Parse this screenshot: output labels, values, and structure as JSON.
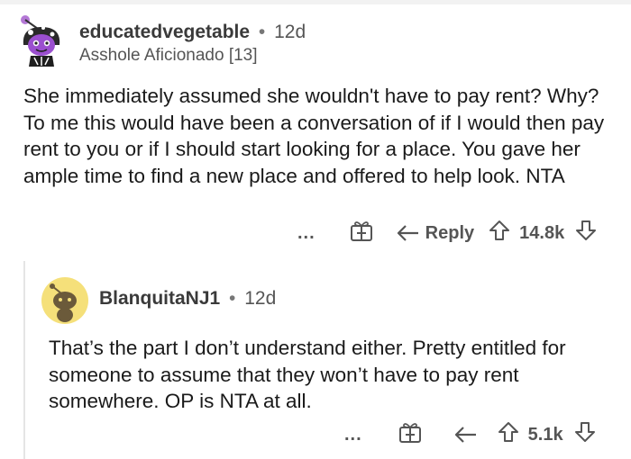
{
  "comment": {
    "username": "educatedvegetable",
    "separator": "•",
    "time": "12d",
    "flair": "Asshole Aficionado [13]",
    "body": "She immediately assumed she wouldn't have to pay rent? Why? To me this would have been a conversation of if I would then pay rent to you or if I should start looking for a place. You gave her ample time to find a new place and offered to help look. NTA",
    "actions": {
      "more": "...",
      "reply_label": "Reply",
      "score": "14.8k"
    },
    "avatar_icon": "snoo-avatar-purple-icon"
  },
  "reply": {
    "username": "BlanquitaNJ1",
    "separator": "•",
    "time": "12d",
    "body": "That’s the part I don’t understand either. Pretty entitled for someone to assume that they won’t have to pay rent somewhere. OP is NTA at all.",
    "actions": {
      "more": "...",
      "score": "5.1k"
    },
    "avatar_icon": "snoo-avatar-default-icon",
    "avatar_bg": "#f5e07a"
  },
  "colors": {
    "text": "#1a1a1a",
    "meta": "#555555",
    "thread_line": "#e5e5e5"
  }
}
